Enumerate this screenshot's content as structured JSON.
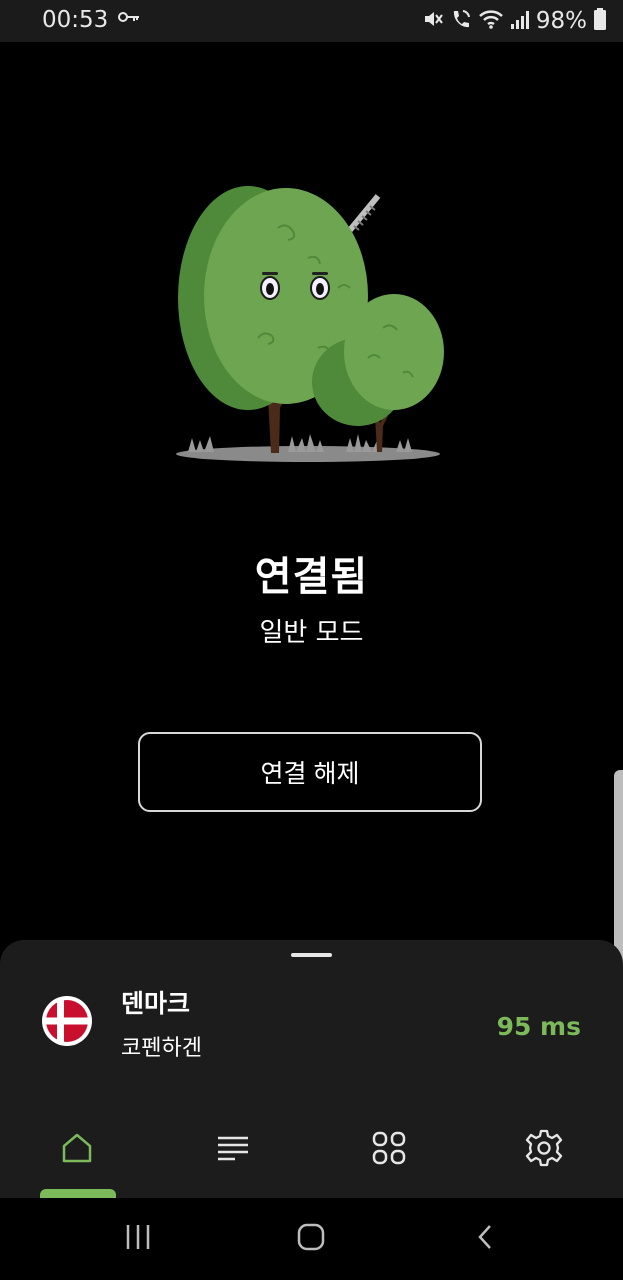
{
  "status_bar": {
    "time": "00:53",
    "battery": "98%",
    "icons": [
      "vpn-key-icon",
      "mute-icon",
      "wifi-call-icon",
      "wifi-icon",
      "signal-icon",
      "battery-icon"
    ]
  },
  "connection": {
    "status": "연결됨",
    "mode": "일반 모드",
    "disconnect_label": "연결 해제"
  },
  "location": {
    "country": "덴마크",
    "city": "코펜하겐",
    "ping": "95 ms",
    "flag": "denmark-flag"
  },
  "bottom_nav": {
    "items": [
      {
        "icon": "home-icon",
        "active": true
      },
      {
        "icon": "list-icon",
        "active": false
      },
      {
        "icon": "apps-grid-icon",
        "active": false
      },
      {
        "icon": "settings-gear-icon",
        "active": false
      }
    ]
  },
  "colors": {
    "accent": "#7cb95a",
    "background": "#000000",
    "sheet": "#1c1c1c"
  }
}
